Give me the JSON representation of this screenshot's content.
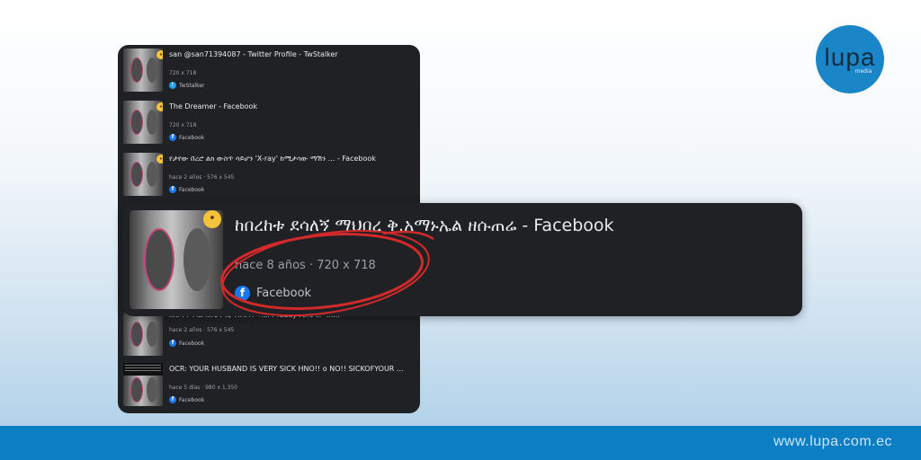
{
  "brand": {
    "logo_text": "lupa",
    "logo_sub": "media",
    "footer_url": "www.lupa.com.ec",
    "colors": {
      "footer": "#0c7fc4",
      "logo": "#1a86c8",
      "annotation": "#d22a2a"
    }
  },
  "results": [
    {
      "title": "san @san71394087 - Twitter Profile - TwStalker",
      "meta": "720 x 718",
      "source": "TwStalker",
      "source_icon": "twstalker-icon"
    },
    {
      "title": "The Dreamer - Facebook",
      "meta": "720 x 718",
      "source": "Facebook",
      "source_icon": "facebook-icon"
    },
    {
      "title": "የታየው በረሮ ልክ ውስጥ ሳይሆን 'X-ray' ከሚታሳው ማሽን ... - Facebook",
      "meta": "hace 2 años · 576 x 545",
      "source": "Facebook",
      "source_icon": "facebook-icon"
    },
    {
      "title": "በበ. የቶሳሳል ዘዘጌ ዶሲ ቀዘዝጎገ ጥዘዘባ Teddy Afro ዘይዳስ...",
      "meta": "hace 2 años · 576 x 545",
      "source": "Facebook",
      "source_icon": "facebook-icon"
    },
    {
      "title": "OCR: YOUR HUSBAND IS VERY SICK HNO!! o NO!! SICKOFYOUR ...",
      "meta": "hace 5 días · 980 x 1.350",
      "source": "Facebook",
      "source_icon": "facebook-icon"
    }
  ],
  "zoomed": {
    "title": "ከበረከቱ ደሳለኝ ማህበረ ቅ.አማኑኤል ዘሱጠሬ - Facebook",
    "meta": "hace 8 años · 720 x 718",
    "source": "Facebook",
    "source_icon": "facebook-icon"
  }
}
